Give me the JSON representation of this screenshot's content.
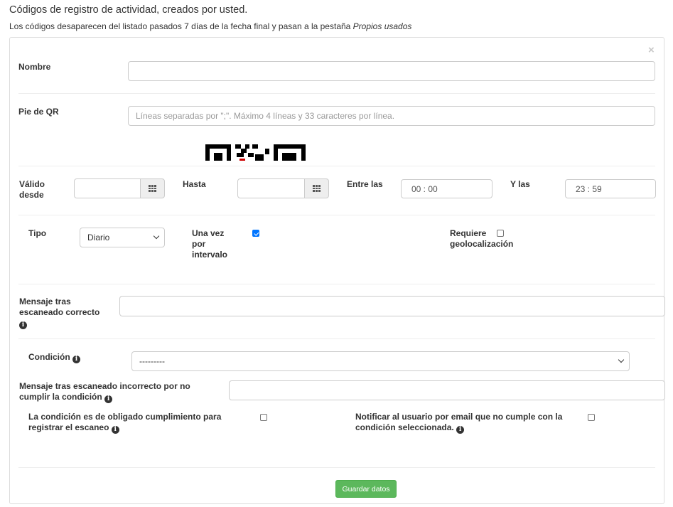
{
  "header": {
    "title": "Códigos de registro de actividad, creados por usted.",
    "subtitle_prefix": "Los códigos desaparecen del listado pasados 7 días de la fecha final y pasan a la pestaña ",
    "subtitle_tab": "Propios usados"
  },
  "form": {
    "close_symbol": "×",
    "nombre": {
      "label": "Nombre",
      "value": ""
    },
    "pie_qr": {
      "label": "Pie de QR",
      "placeholder": "Líneas separadas por \";\". Máximo 4 líneas y 33 caracteres por línea."
    },
    "valido_desde": {
      "label_line1": "Válido",
      "label_line2": "desde",
      "value": "",
      "icon": "calendar-grid-icon"
    },
    "hasta": {
      "label": "Hasta",
      "value": "",
      "icon": "calendar-grid-icon"
    },
    "entre_las": {
      "label": "Entre las",
      "value": "00 : 00"
    },
    "y_las": {
      "label": "Y las",
      "value": "23 : 59"
    },
    "tipo": {
      "label": "Tipo",
      "selected": "Diario"
    },
    "una_vez": {
      "label_line1": "Una vez",
      "label_line2": "por",
      "label_line3": "intervalo",
      "checked": true
    },
    "geoloc": {
      "label_line1": "Requiere",
      "label_line2": "geolocalización",
      "checked": false
    },
    "mensaje_ok": {
      "label_line1": "Mensaje tras",
      "label_line2": "escaneado correcto",
      "value": ""
    },
    "condicion": {
      "label": "Condición",
      "selected": "---------"
    },
    "mensaje_ko": {
      "label_line1": "Mensaje tras escaneado incorrecto por no",
      "label_line2": "cumplir la condición",
      "value": ""
    },
    "obligado": {
      "label_line1": "La condición es de obligado cumplimiento para",
      "label_line2": "registrar el escaneo",
      "checked": false
    },
    "notificar": {
      "label_line1": "Notificar al usuario por email que no cumple con la",
      "label_line2": "condición seleccionada.",
      "checked": false
    },
    "save_label": "Guardar datos"
  },
  "colors": {
    "save_button": "#5cb85c",
    "checkbox_checked": "#0075ff",
    "border": "#cccccc"
  }
}
